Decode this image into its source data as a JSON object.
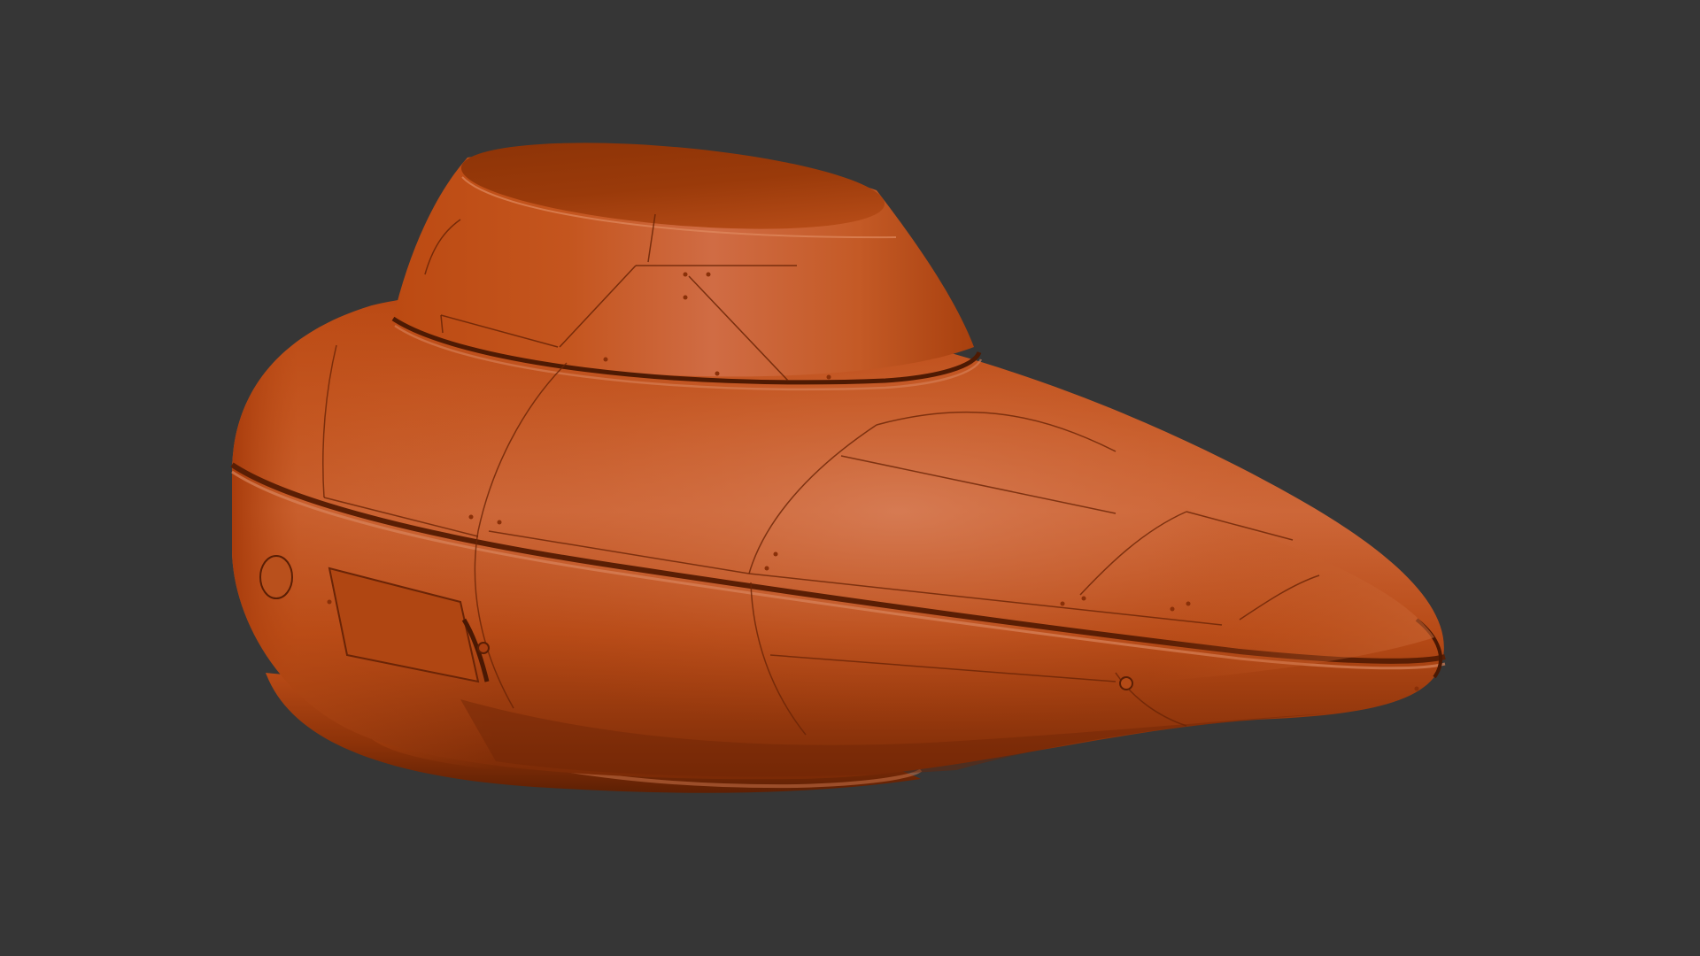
{
  "scene": {
    "background_color": "#363636",
    "object": {
      "type": "3d-render",
      "subject": "spacecraft-pod",
      "material_color": "#c4531c",
      "highlight_color": "#d8784e",
      "shadow_color": "#6e2606"
    }
  }
}
